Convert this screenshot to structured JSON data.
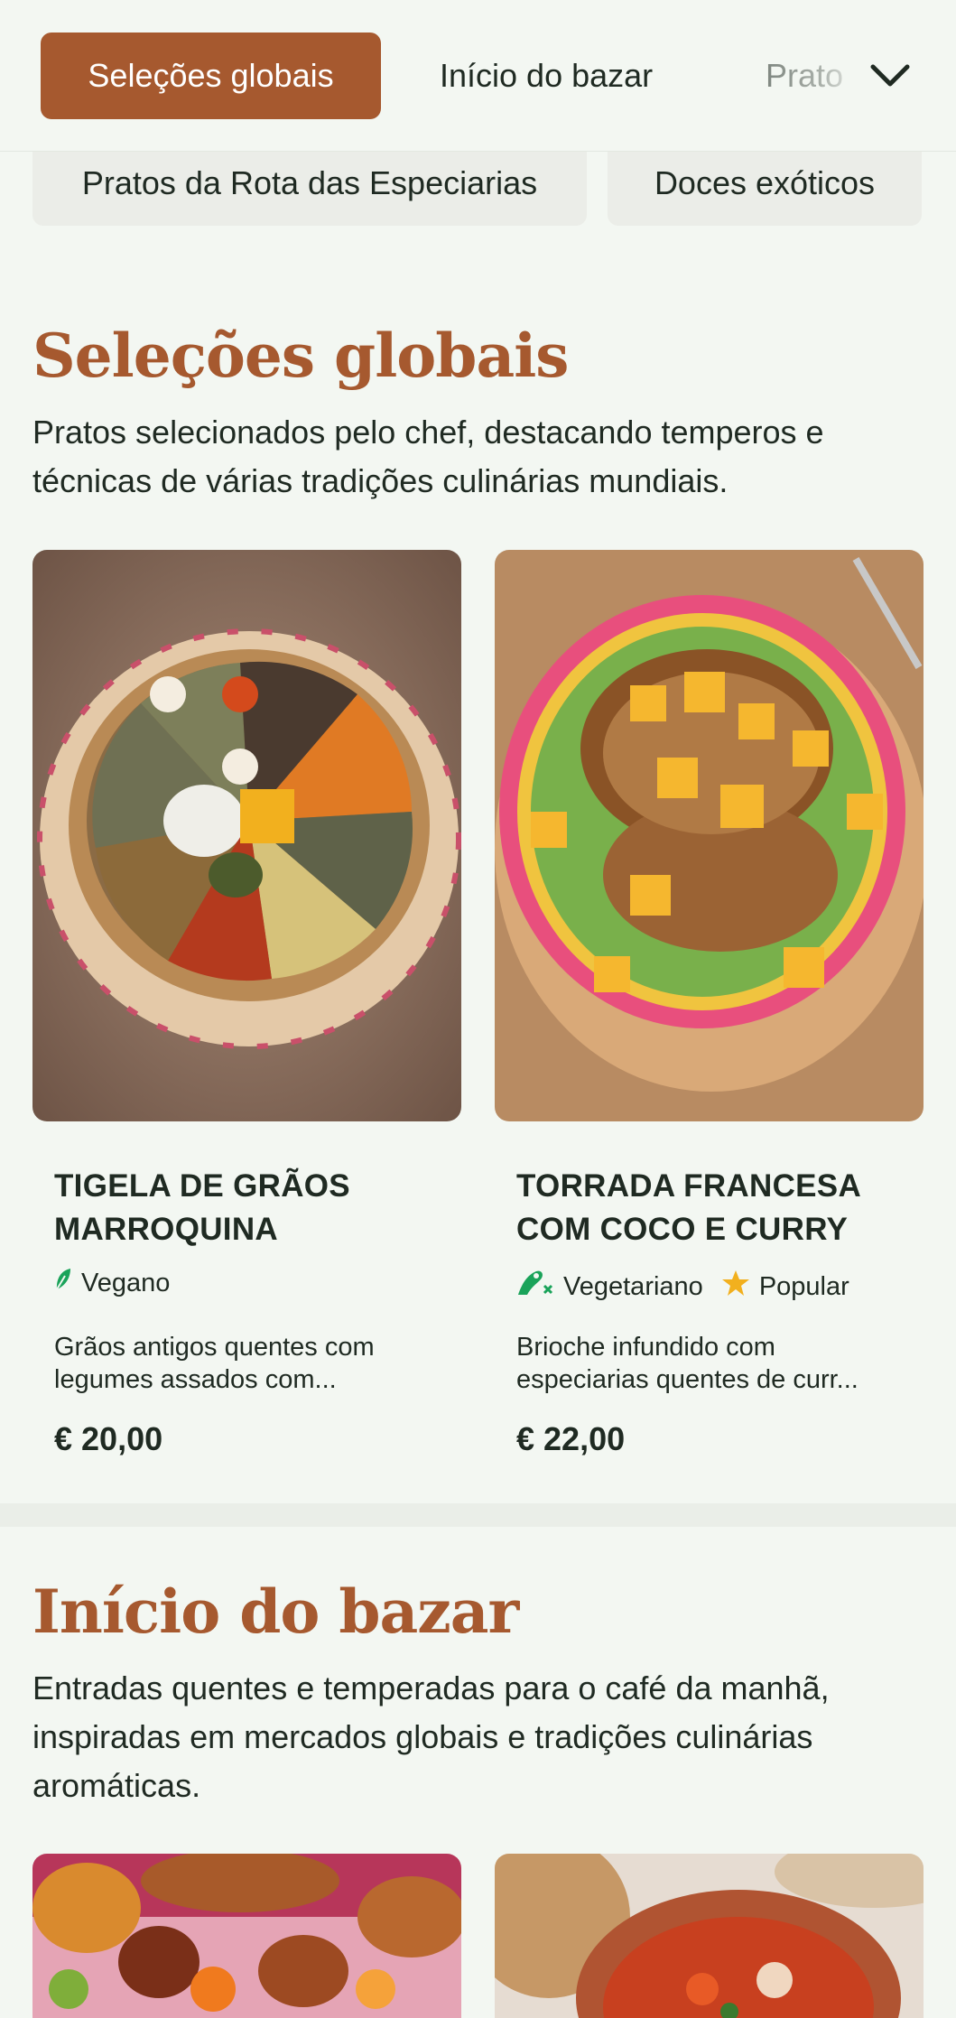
{
  "nav": {
    "tabs": [
      "Seleções globais",
      "Início do bazar",
      "Prato"
    ],
    "chips": [
      "Pratos da Rota das Especiarias",
      "Doces exóticos"
    ]
  },
  "sections": [
    {
      "title": "Seleções globais",
      "description": "Pratos selecionados pelo chef, destacando temperos e técnicas de várias tradições culinárias mundiais.",
      "items": [
        {
          "title": "TIGELA DE GRÃOS MARROQUINA",
          "tags": [
            {
              "label": "Vegano",
              "icon": "leaf-icon"
            }
          ],
          "description_line1": "Grãos antigos quentes com",
          "description_line2": "legumes assados com...",
          "price": "€ 20,00"
        },
        {
          "title": "TORRADA FRANCESA COM COCO E CURRY",
          "tags": [
            {
              "label": "Vegetariano",
              "icon": "vegetarian-icon"
            },
            {
              "label": "Popular",
              "icon": "star-icon"
            }
          ],
          "description_line1": "Brioche infundido com",
          "description_line2": "especiarias quentes de curr...",
          "price": "€ 22,00"
        }
      ]
    },
    {
      "title": "Início do bazar",
      "description": "Entradas quentes e temperadas para o café da manhã, inspiradas em mercados globais e tradições culinárias aromáticas."
    }
  ],
  "colors": {
    "accent": "#a6592f",
    "background": "#f3f7f2",
    "text": "#1f2a22",
    "leaf": "#1aa35a",
    "star": "#f2b01e"
  }
}
